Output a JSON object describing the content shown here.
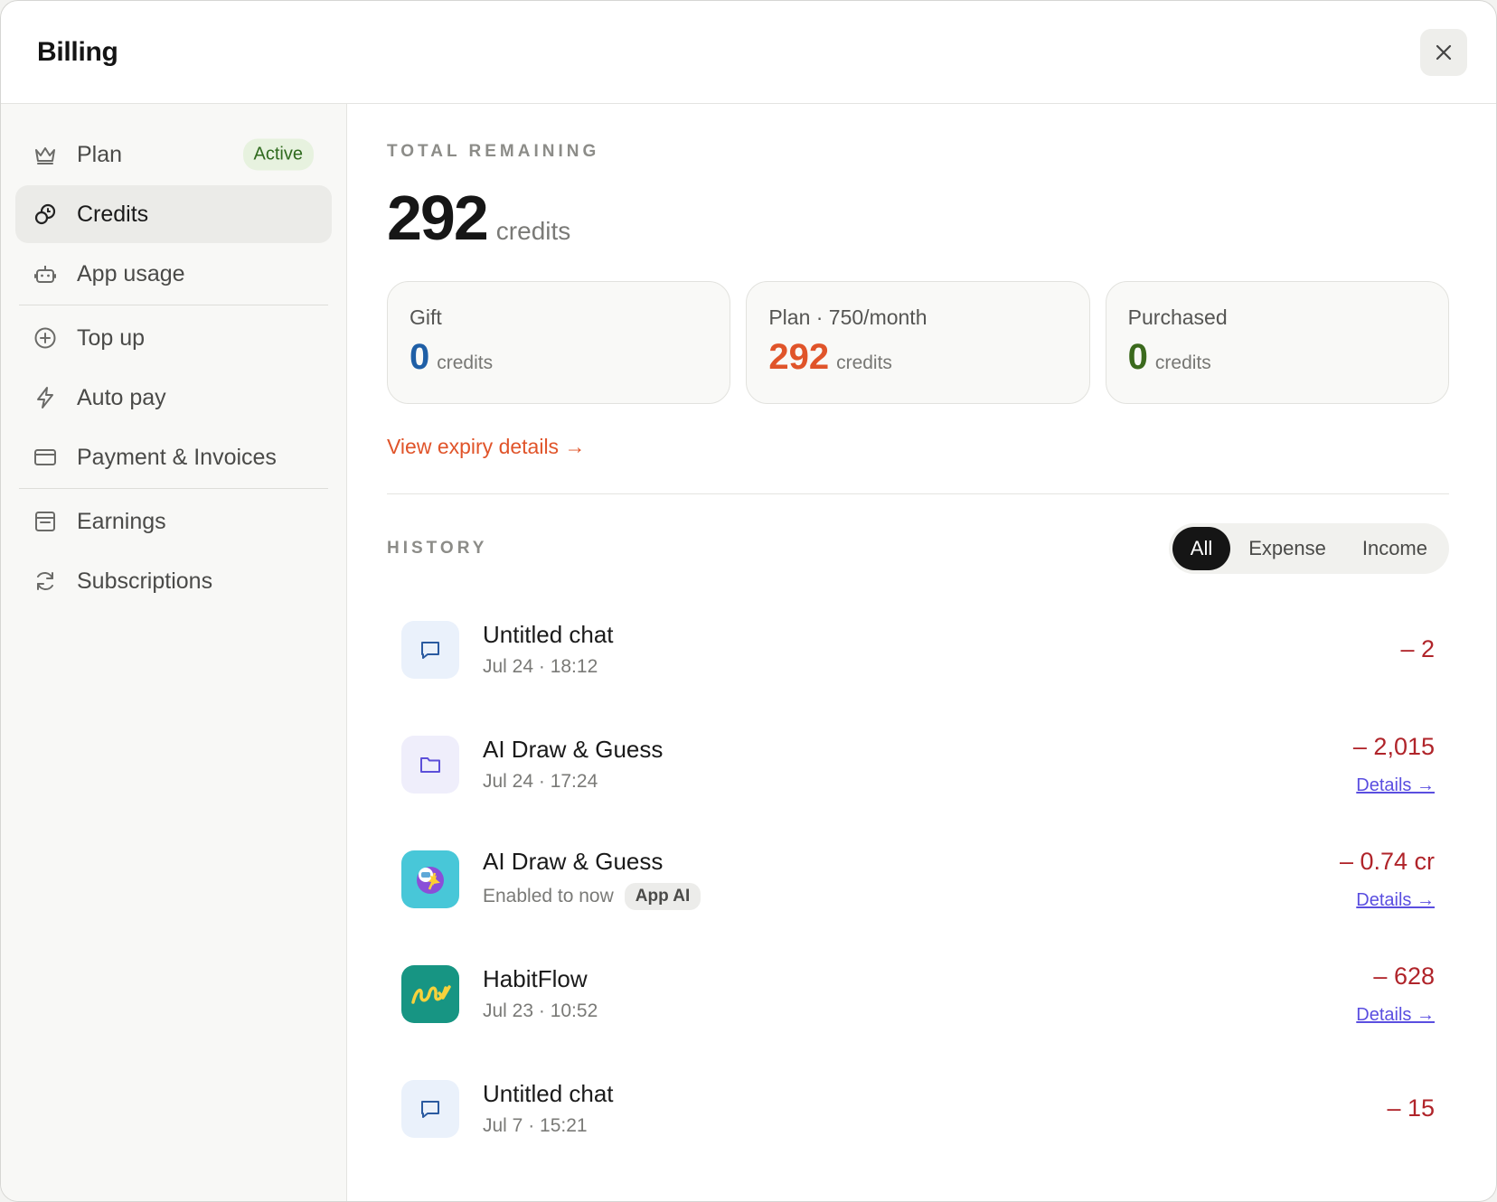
{
  "header": {
    "title": "Billing"
  },
  "sidebar": {
    "items": [
      {
        "label": "Plan",
        "badge": "Active"
      },
      {
        "label": "Credits"
      },
      {
        "label": "App usage"
      },
      {
        "label": "Top up"
      },
      {
        "label": "Auto pay"
      },
      {
        "label": "Payment & Invoices"
      },
      {
        "label": "Earnings"
      },
      {
        "label": "Subscriptions"
      }
    ]
  },
  "credits": {
    "eyebrow": "TOTAL REMAINING",
    "total": "292",
    "unit": "credits",
    "cards": [
      {
        "title": "Gift",
        "value": "0",
        "unit": "credits",
        "color": "#1f5fa6"
      },
      {
        "title": "Plan · 750/month",
        "value": "292",
        "unit": "credits",
        "color": "#e0542a"
      },
      {
        "title": "Purchased",
        "value": "0",
        "unit": "credits",
        "color": "#3b6a1d"
      }
    ],
    "expiry_link": "View expiry details →"
  },
  "history": {
    "eyebrow": "HISTORY",
    "filters": [
      "All",
      "Expense",
      "Income"
    ],
    "selected_filter": "All",
    "rows": [
      {
        "icon": "chat-icon",
        "title": "Untitled chat",
        "sub": "Jul 24 · 18:12",
        "amount": "– 2"
      },
      {
        "icon": "folder-icon",
        "title": "AI Draw & Guess",
        "sub": "Jul 24 · 17:24",
        "amount": "– 2,015",
        "details": "Details →"
      },
      {
        "icon": "app-draw-guess-icon",
        "title": "AI Draw & Guess",
        "sub": "Enabled to now",
        "tag": "App AI",
        "amount": "– 0.74 cr",
        "details": "Details →"
      },
      {
        "icon": "habitflow-icon",
        "title": "HabitFlow",
        "sub": "Jul 23 · 10:52",
        "amount": "– 628",
        "details": "Details →"
      },
      {
        "icon": "chat-icon",
        "title": "Untitled chat",
        "sub": "Jul 7 · 15:21",
        "amount": "– 15"
      }
    ]
  }
}
